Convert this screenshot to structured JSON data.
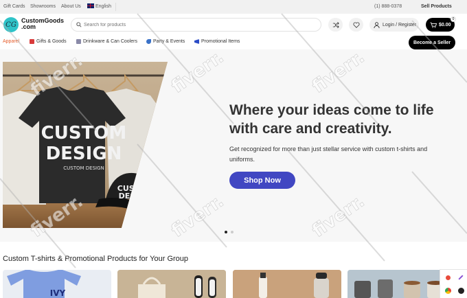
{
  "topbar": {
    "links": [
      "Gift Cards",
      "Showrooms",
      "About Us"
    ],
    "language": "English",
    "phone": "(1) 888-0378",
    "sell_link": "Sell Products"
  },
  "header": {
    "logo_mark": "CG",
    "logo_line1": "CustomGoods",
    "logo_line2": ".com",
    "search_placeholder": "Search for products",
    "login_label": "Login / Register",
    "cart_total": "$0.00",
    "cart_count": "0"
  },
  "categories": [
    {
      "label": "Apparel",
      "active": true
    },
    {
      "label": "Gifts & Goods",
      "icon": "gift-icon",
      "color": "#d83a3a"
    },
    {
      "label": "Drinkware & Can Coolers",
      "icon": "cup-icon",
      "color": "#7a7a9a"
    },
    {
      "label": "Party & Events",
      "icon": "party-icon",
      "color": "#3a72c8"
    },
    {
      "label": "Promotional Items",
      "icon": "megaphone-icon",
      "color": "#2c4cc6"
    }
  ],
  "become_seller": "Become a Seller",
  "hero": {
    "headline_line1": "Where your ideas come to life",
    "headline_line2": "with care and creativity.",
    "subtext": "Get recognized for more than just stellar service with custom t-shirts and uniforms.",
    "cta": "Shop Now",
    "image_shirt_text1": "CUSTOM",
    "image_shirt_text2": "DESIGN",
    "image_shirt_text3": "CUSTOM DESIGN",
    "image_cap_text1": "CUST",
    "image_cap_text2": "DESI",
    "slides": 2,
    "active_slide": 1
  },
  "section": {
    "title": "Custom T-shirts & Promotional Products for Your Group",
    "card1_text": "IVY"
  },
  "colors": {
    "accent": "#4147c2",
    "logo": "#2fc3c8",
    "active_category": "#e65c2a"
  },
  "watermark": "fiverr."
}
